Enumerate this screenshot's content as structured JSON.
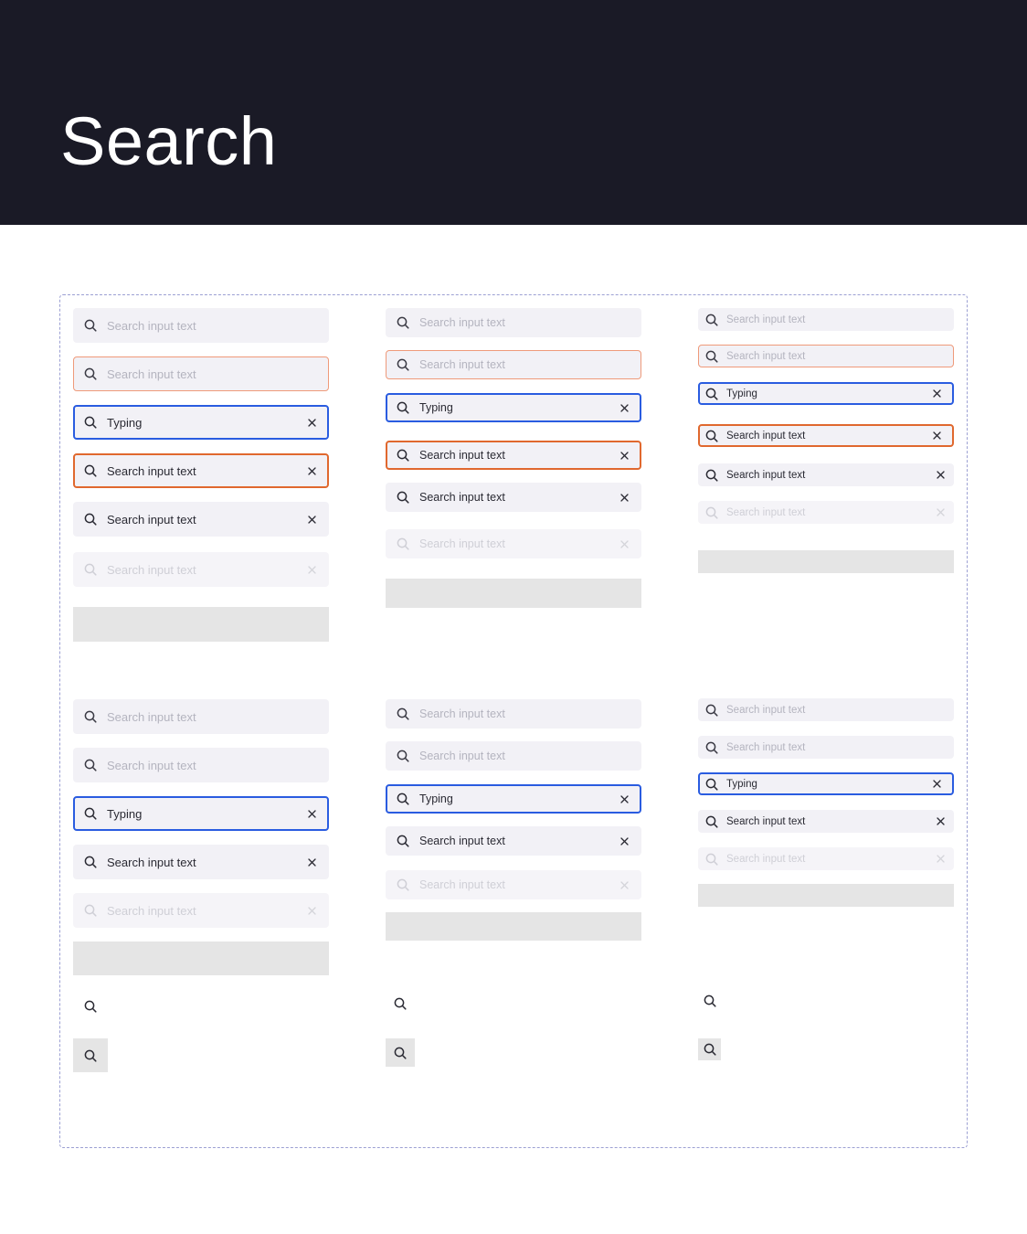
{
  "header": {
    "title": "Search"
  },
  "colors": {
    "header_bg": "#1a1a26",
    "field_bg": "#f2f1f6",
    "focus": "#2a5ce0",
    "error": "#e0682e",
    "hover": "#ef9a7a",
    "skeleton": "#e5e5e5",
    "frame_border": "#9ca0d3"
  },
  "icons": {
    "search": "search-icon",
    "clear": "close-icon"
  },
  "text": {
    "placeholder": "Search input text",
    "typing": "Typing",
    "filled": "Search input text"
  }
}
